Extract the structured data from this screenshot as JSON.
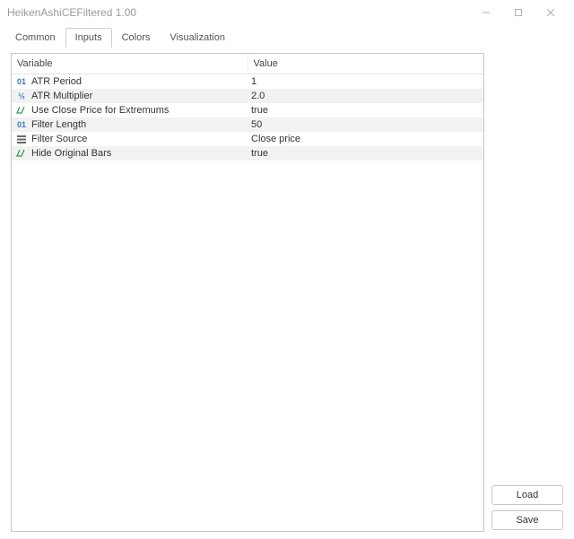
{
  "window": {
    "title": "HeikenAshiCEFiltered 1.00"
  },
  "tabs": [
    {
      "label": "Common",
      "active": false
    },
    {
      "label": "Inputs",
      "active": true
    },
    {
      "label": "Colors",
      "active": false
    },
    {
      "label": "Visualization",
      "active": false
    }
  ],
  "table": {
    "headers": {
      "variable": "Variable",
      "value": "Value"
    },
    "rows": [
      {
        "icon": "int",
        "label": "ATR Period",
        "value": "1"
      },
      {
        "icon": "double",
        "label": "ATR Multiplier",
        "value": "2.0"
      },
      {
        "icon": "bool",
        "label": "Use Close Price for Extremums",
        "value": "true"
      },
      {
        "icon": "int",
        "label": "Filter Length",
        "value": "50"
      },
      {
        "icon": "enum",
        "label": "Filter Source",
        "value": "Close price"
      },
      {
        "icon": "bool",
        "label": "Hide Original Bars",
        "value": "true"
      }
    ]
  },
  "buttons": {
    "load": "Load",
    "save": "Save"
  }
}
